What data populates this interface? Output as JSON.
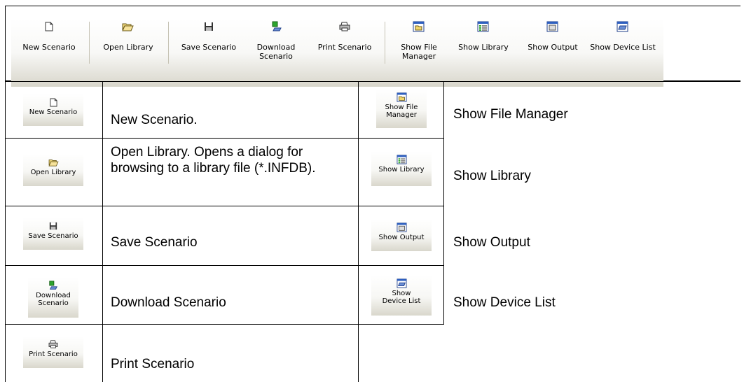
{
  "toolbar": {
    "buttons": [
      {
        "label": "New Scenario",
        "icon": "new-doc-icon"
      },
      {
        "label": "Open Library",
        "icon": "open-folder-icon"
      },
      {
        "label": "Save Scenario",
        "icon": "floppy-disk-icon"
      },
      {
        "label": "Download Scenario",
        "icon": "download-device-icon"
      },
      {
        "label": "Print Scenario",
        "icon": "printer-icon"
      },
      {
        "label": "Show File Manager",
        "icon": "file-manager-icon"
      },
      {
        "label": "Show Library",
        "icon": "library-list-icon"
      },
      {
        "label": "Show Output",
        "icon": "output-window-icon"
      },
      {
        "label": "Show Device List",
        "icon": "device-list-icon"
      }
    ]
  },
  "left_rows": [
    {
      "button": "New Scenario",
      "text": "New Scenario."
    },
    {
      "button": "Open Library",
      "text": "Open Library.  Opens a dialog for browsing to a library file (*.INFDB)."
    },
    {
      "button": "Save Scenario",
      "text": "Save Scenario"
    },
    {
      "button": "Download Scenario",
      "text": "Download Scenario"
    },
    {
      "button": "Print Scenario",
      "text": "Print Scenario"
    }
  ],
  "right_rows": [
    {
      "button": "Show File Manager",
      "text": "Show File Manager"
    },
    {
      "button": "Show Library",
      "text": "Show Library"
    },
    {
      "button": "Show Output",
      "text": "Show Output"
    },
    {
      "button": "Show Device List",
      "text": "Show Device List"
    }
  ]
}
